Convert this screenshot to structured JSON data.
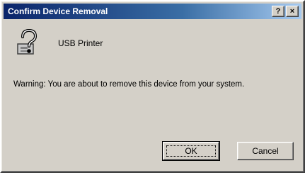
{
  "window": {
    "title": "Confirm Device Removal",
    "help_label": "?",
    "close_label": "×"
  },
  "device": {
    "name": "USB Printer",
    "icon": "question-device-icon"
  },
  "message": {
    "warning": "Warning: You are about to remove this device from your system."
  },
  "buttons": {
    "ok_label": "OK",
    "cancel_label": "Cancel"
  },
  "colors": {
    "titlebar_start": "#0a246a",
    "titlebar_end": "#a6caf0",
    "face": "#d4d0c8"
  }
}
